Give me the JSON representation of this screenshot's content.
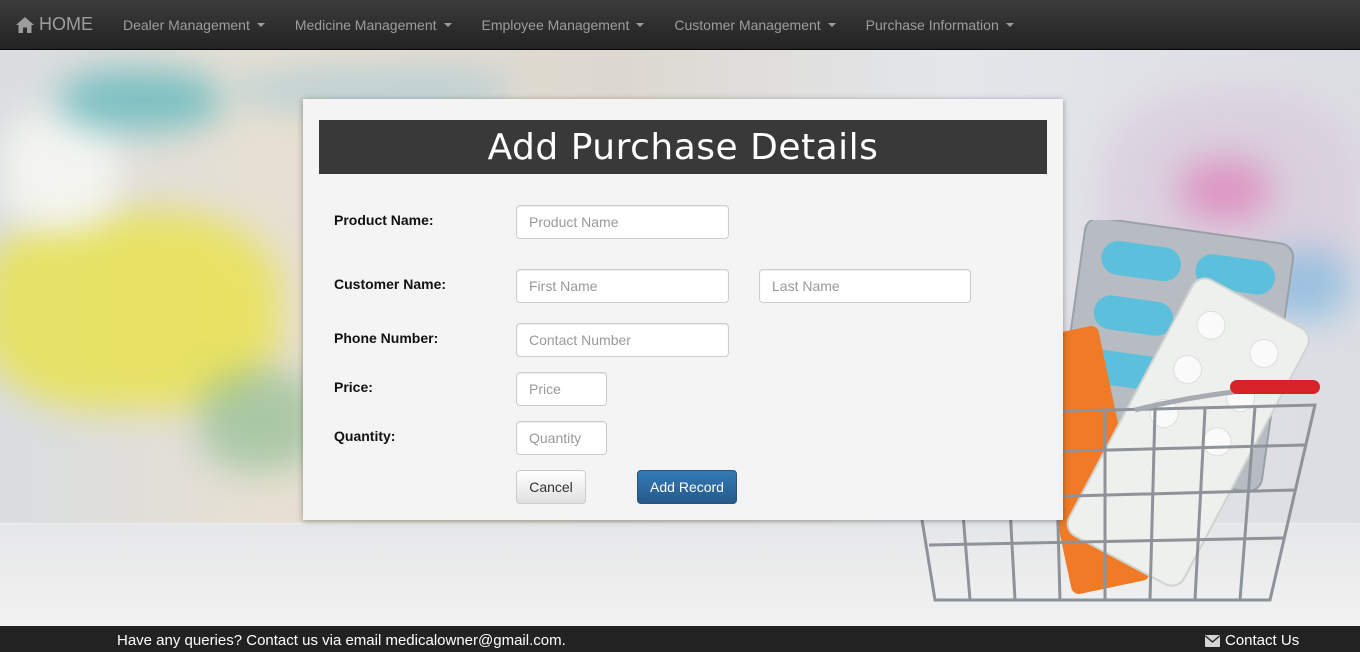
{
  "navbar": {
    "brand": "HOME",
    "items": [
      {
        "label": "Dealer Management"
      },
      {
        "label": "Medicine Management"
      },
      {
        "label": "Employee Management"
      },
      {
        "label": "Customer Management"
      },
      {
        "label": "Purchase Information"
      }
    ]
  },
  "form": {
    "title": "Add Purchase Details",
    "product_label": "Product Name:",
    "product_placeholder": "Product Name",
    "customer_label": "Customer Name:",
    "first_name_placeholder": "First Name",
    "last_name_placeholder": "Last Name",
    "phone_label": "Phone Number:",
    "phone_placeholder": "Contact Number",
    "price_label": "Price:",
    "price_placeholder": "Price",
    "quantity_label": "Quantity:",
    "quantity_placeholder": "Quantity",
    "cancel_label": "Cancel",
    "add_label": "Add Record"
  },
  "footer": {
    "text": "Have any queries? Contact us via email medicalowner@gmail.com.",
    "contact_label": "Contact Us"
  },
  "icons": {
    "brand": "home-icon",
    "contact": "envelope-icon",
    "dropdown": "caret-down-icon"
  },
  "colors": {
    "navbar": "#222222",
    "panel_title_bg": "#393939",
    "primary_button": "#337ab7",
    "footer": "#222222"
  }
}
